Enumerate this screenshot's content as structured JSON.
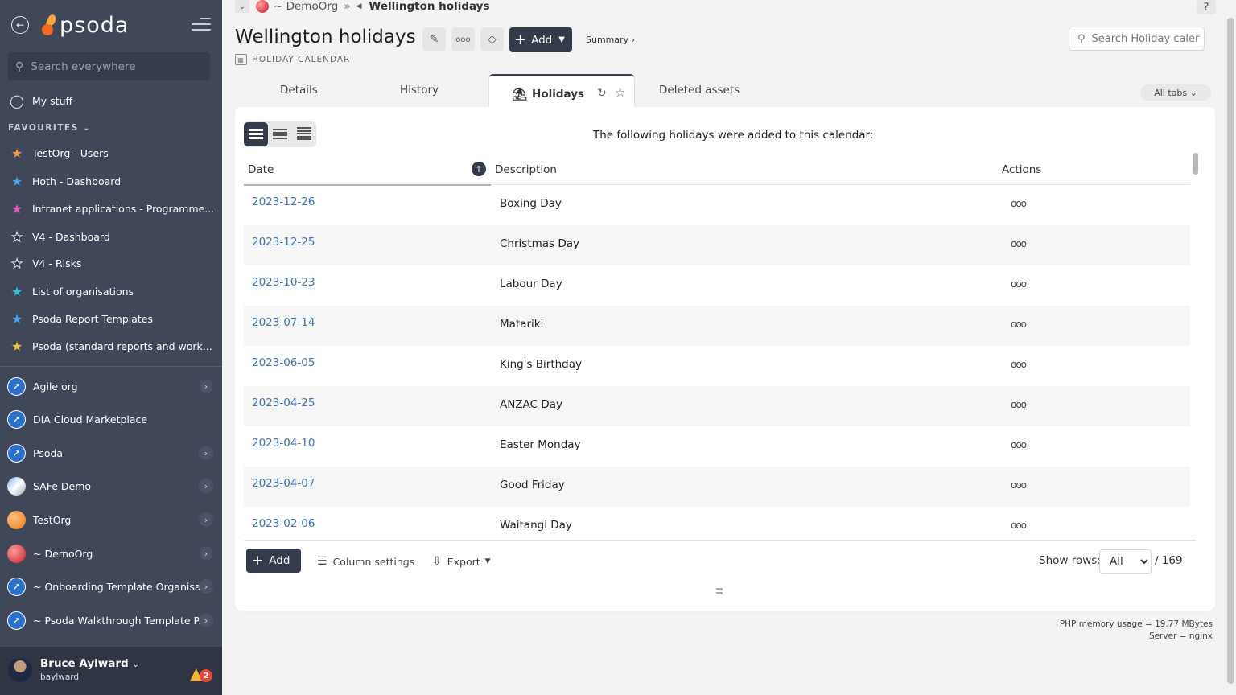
{
  "sidebar": {
    "logo": "psoda",
    "search_placeholder": "Search everywhere",
    "my_stuff": "My stuff",
    "favourites_heading": "FAVOURITES",
    "favourites": [
      {
        "label": "TestOrg - Users",
        "color": "#f79a3e"
      },
      {
        "label": "Hoth - Dashboard",
        "color": "#4aa3e8"
      },
      {
        "label": "Intranet applications - Programme...",
        "color": "#e357c7"
      },
      {
        "label": "V4 - Dashboard",
        "color": "#2a2f3a"
      },
      {
        "label": "V4 - Risks",
        "color": "#2a2f3a"
      },
      {
        "label": "List of organisations",
        "color": "#2fc3d8"
      },
      {
        "label": "Psoda Report Templates",
        "color": "#4aa3e8"
      },
      {
        "label": "Psoda (standard reports and work...",
        "color": "#f0c13a"
      }
    ],
    "orgs": [
      {
        "label": "Agile org",
        "icon": "rocket-icon"
      },
      {
        "label": "DIA Cloud Marketplace",
        "icon": "rocket-icon"
      },
      {
        "label": "Psoda",
        "icon": "rocket-icon"
      },
      {
        "label": "SAFe Demo",
        "icon": "safe-logo-icon"
      },
      {
        "label": "TestOrg",
        "icon": "testorg-logo-icon"
      },
      {
        "label": "~ DemoOrg",
        "icon": "demoorg-logo-icon"
      },
      {
        "label": "~ Onboarding Template Organisa...",
        "icon": "rocket-icon"
      },
      {
        "label": "~ Psoda Walkthrough Template P...",
        "icon": "rocket-icon"
      }
    ],
    "user": {
      "name": "Bruce Aylward",
      "login": "baylward",
      "notifications": "2"
    }
  },
  "header": {
    "breadcrumb_org": "~ DemoOrg",
    "breadcrumb_current": "Wellington holidays",
    "help": "?",
    "title": "Wellington holidays",
    "add_label": "Add",
    "summary_link": "Summary ›",
    "subtitle": "HOLIDAY CALENDAR",
    "search_placeholder": "Search Holiday caler"
  },
  "tabs": {
    "details": "Details",
    "history": "History",
    "holidays": "Holidays",
    "deleted": "Deleted assets",
    "all_tabs": "All tabs"
  },
  "table": {
    "intro": "The following holidays were added to this calendar:",
    "columns": {
      "date": "Date",
      "description": "Description",
      "actions": "Actions"
    },
    "rows": [
      {
        "date": "2023-12-26",
        "description": "Boxing Day"
      },
      {
        "date": "2023-12-25",
        "description": "Christmas Day"
      },
      {
        "date": "2023-10-23",
        "description": "Labour Day"
      },
      {
        "date": "2023-07-14",
        "description": "Matariki"
      },
      {
        "date": "2023-06-05",
        "description": "King's Birthday"
      },
      {
        "date": "2023-04-25",
        "description": "ANZAC Day"
      },
      {
        "date": "2023-04-10",
        "description": "Easter Monday"
      },
      {
        "date": "2023-04-07",
        "description": "Good Friday"
      },
      {
        "date": "2023-02-06",
        "description": "Waitangi Day"
      }
    ],
    "action_glyph": "ooo",
    "add_label": "Add",
    "column_settings": "Column settings",
    "export": "Export",
    "show_rows_label": "Show rows:",
    "show_rows_value": "All",
    "total": "/ 169"
  },
  "footer": {
    "memory": "PHP memory usage = 19.77 MBytes",
    "server": "Server = nginx"
  },
  "colors": {
    "sidebar_bg": "#3f4758",
    "accent_dark": "#343b4b",
    "link": "#3f73b5"
  }
}
